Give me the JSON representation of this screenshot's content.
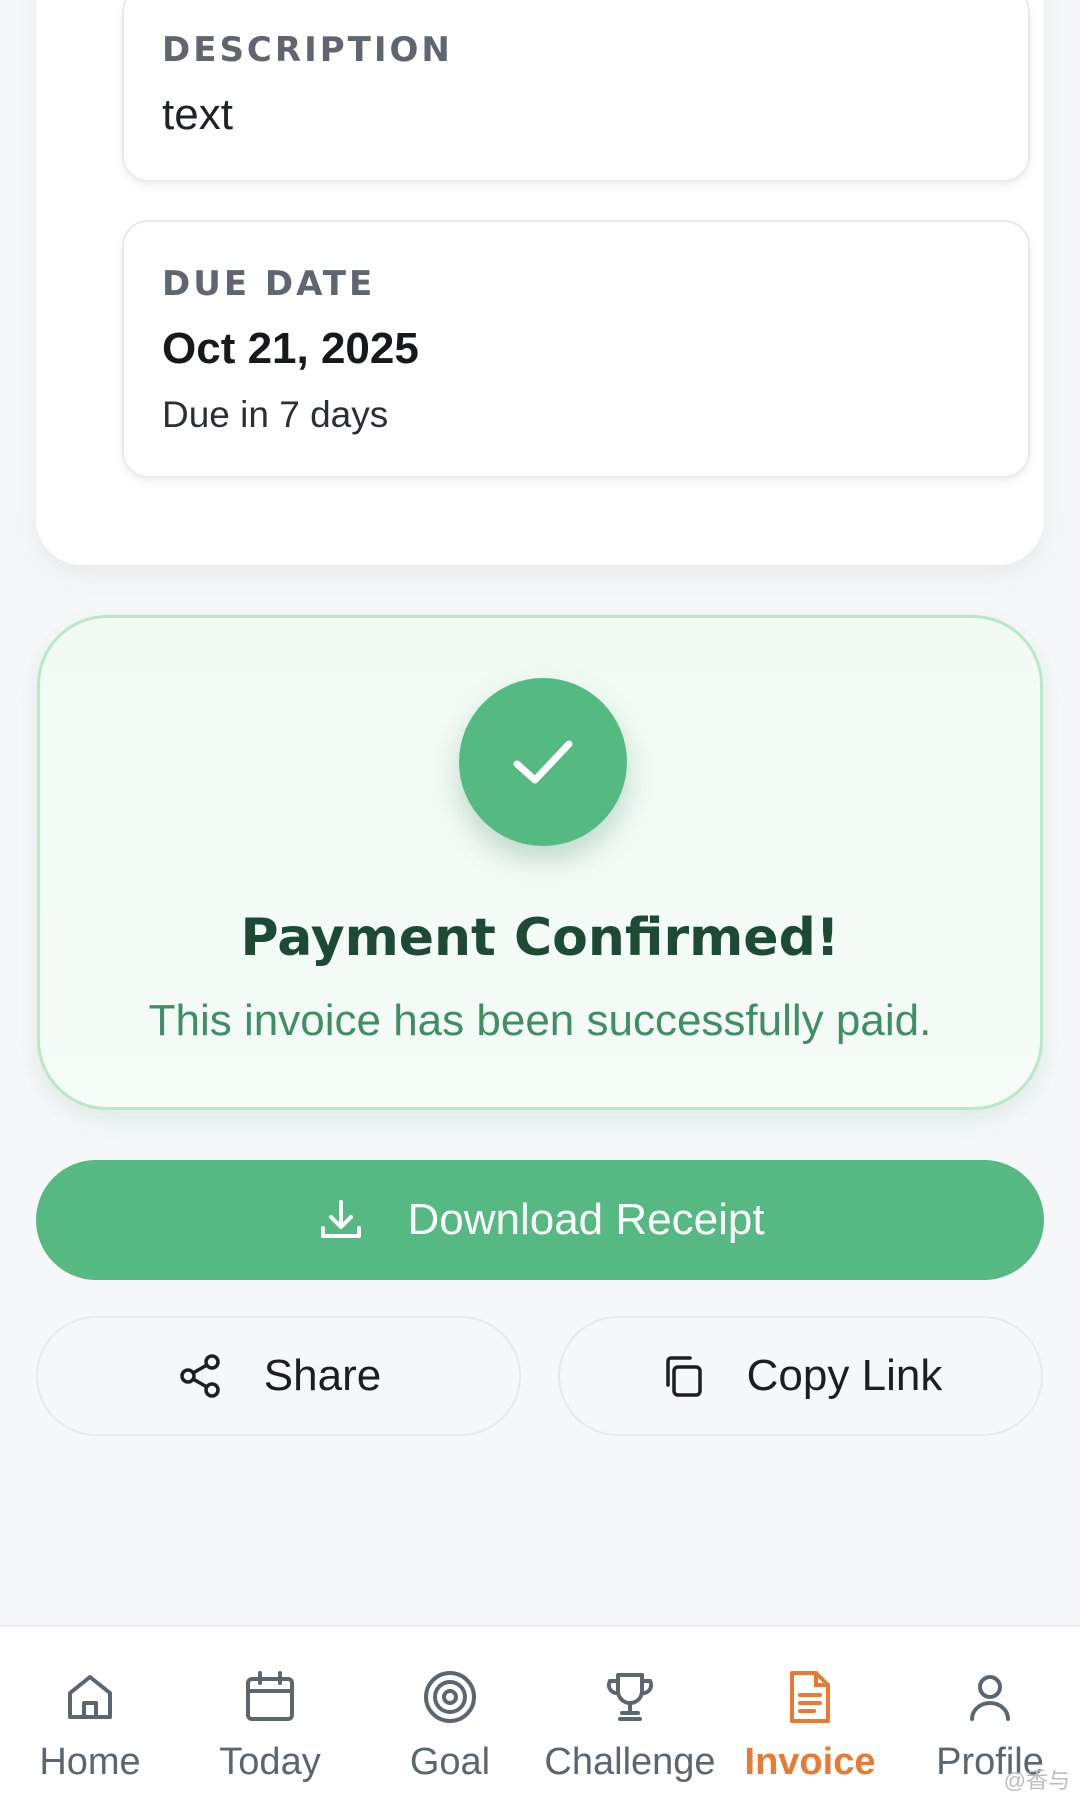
{
  "description_field": {
    "label": "DESCRIPTION",
    "value": "text"
  },
  "due_date_field": {
    "label": "DUE DATE",
    "value": "Oct 21, 2025",
    "sub": "Due in 7 days"
  },
  "confirmation": {
    "icon": "check-icon",
    "title": "Payment Confirmed!",
    "subtitle": "This invoice has been successfully paid."
  },
  "actions": {
    "download_label": "Download Receipt",
    "share_label": "Share",
    "copy_label": "Copy Link"
  },
  "nav": {
    "items": [
      {
        "label": "Home",
        "icon": "home-icon"
      },
      {
        "label": "Today",
        "icon": "calendar-icon"
      },
      {
        "label": "Goal",
        "icon": "target-icon"
      },
      {
        "label": "Challenge",
        "icon": "trophy-icon"
      },
      {
        "label": "Invoice",
        "icon": "document-icon",
        "active": true
      },
      {
        "label": "Profile",
        "icon": "user-icon"
      }
    ]
  },
  "watermark": "@香与",
  "colors": {
    "accent_green": "#56b982",
    "active_orange": "#ea7a32",
    "confirm_text": "#1d4a33"
  }
}
